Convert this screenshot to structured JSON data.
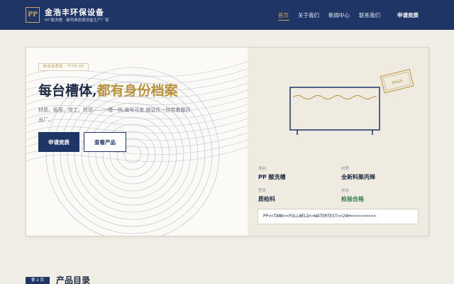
{
  "header": {
    "logo_text": "PP",
    "brand_name": "金浩丰环保设备",
    "brand_sub": "PP 酸洗槽 · 聚丙烯防腐设备生产厂家",
    "nav": [
      {
        "label": "首页"
      },
      {
        "label": "关于我们"
      },
      {
        "label": "新闻中心"
      },
      {
        "label": "联系我们"
      }
    ],
    "cta": "申请资质"
  },
  "hero": {
    "tag": "制造资质表 · TYPE PP",
    "title_main": "每台槽体,",
    "title_accent": "都有身份档案",
    "description": "材质、板厚、焊工、检验——一槽一档,编号可查,随证件一样带着履历出厂。",
    "btn_primary": "申请资质",
    "btn_secondary": "查看产品"
  },
  "card_right": {
    "stamp": "PASS",
    "fields": [
      {
        "label": "类别",
        "value": "PP 酸洗槽"
      },
      {
        "label": "材质",
        "value": "全新料聚丙烯"
      },
      {
        "label": "签发",
        "value": "质检科"
      },
      {
        "label": "状态",
        "value": "检验合格"
      }
    ],
    "code": "PP<<TANK<<FULLWELD<<WATERTEST<<24H<<<<<<<<<<"
  },
  "section": {
    "badge": "第 2 页",
    "title": "产品目录"
  },
  "colors": {
    "navy": "#1e3566",
    "gold": "#c7a657",
    "pass_green": "#2f7d4a"
  }
}
